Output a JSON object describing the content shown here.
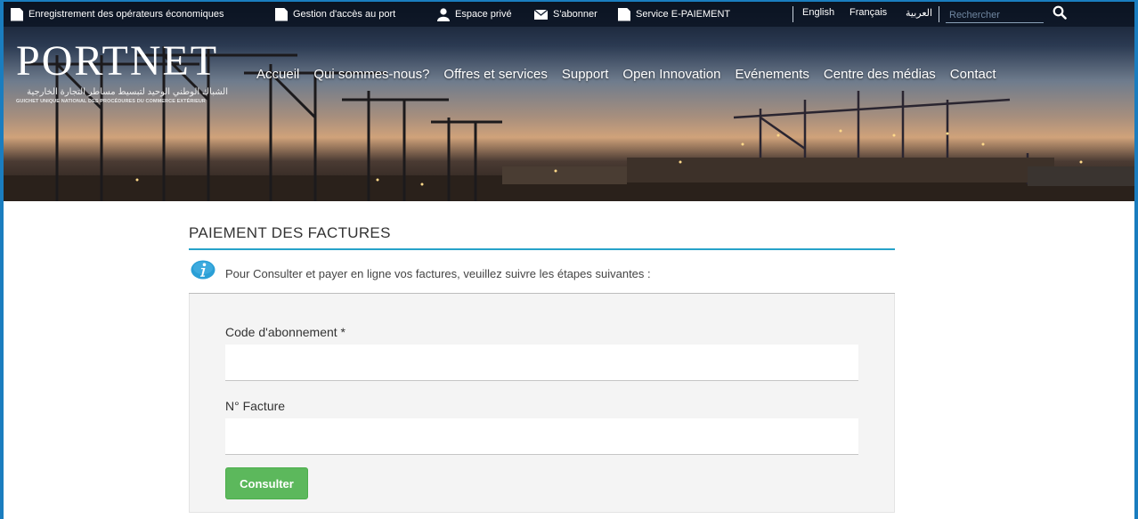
{
  "header": {
    "utility_links": [
      {
        "label": "Enregistrement des opérateurs économiques",
        "icon": "document-icon"
      },
      {
        "label": "Gestion d'accès au port",
        "icon": "document-icon"
      },
      {
        "label": "Espace privé",
        "icon": "user-icon"
      },
      {
        "label": "S'abonner",
        "icon": "envelope-icon"
      },
      {
        "label": "Service E-PAIEMENT",
        "icon": "document-icon"
      }
    ],
    "languages": [
      "English",
      "Français",
      "العربية"
    ],
    "search_placeholder": "Rechercher",
    "logo": {
      "name": "PORTNET",
      "arabic_tagline": "الشباك الوطني الوحيد لتبسيط مساطر التجارة الخارجية",
      "french_tagline": "GUICHET UNIQUE NATIONAL DES PROCÉDURES DU COMMERCE EXTÉRIEUR"
    },
    "main_nav": [
      "Accueil",
      "Qui sommes-nous?",
      "Offres et services",
      "Support",
      "Open Innovation",
      "Evénements",
      "Centre des médias",
      "Contact"
    ]
  },
  "main": {
    "title": "PAIEMENT DES FACTURES",
    "info_text": "Pour Consulter et payer en ligne vos factures, veuillez suivre les étapes suivantes :",
    "form": {
      "subscription_label": "Code d'abonnement *",
      "subscription_value": "",
      "invoice_label": "N° Facture",
      "invoice_value": "",
      "submit_label": "Consulter"
    }
  },
  "colors": {
    "frame": "#1a7dbf",
    "title_rule": "#27a3c9",
    "info_icon": "#2a9fd6",
    "button": "#5cb85c"
  }
}
